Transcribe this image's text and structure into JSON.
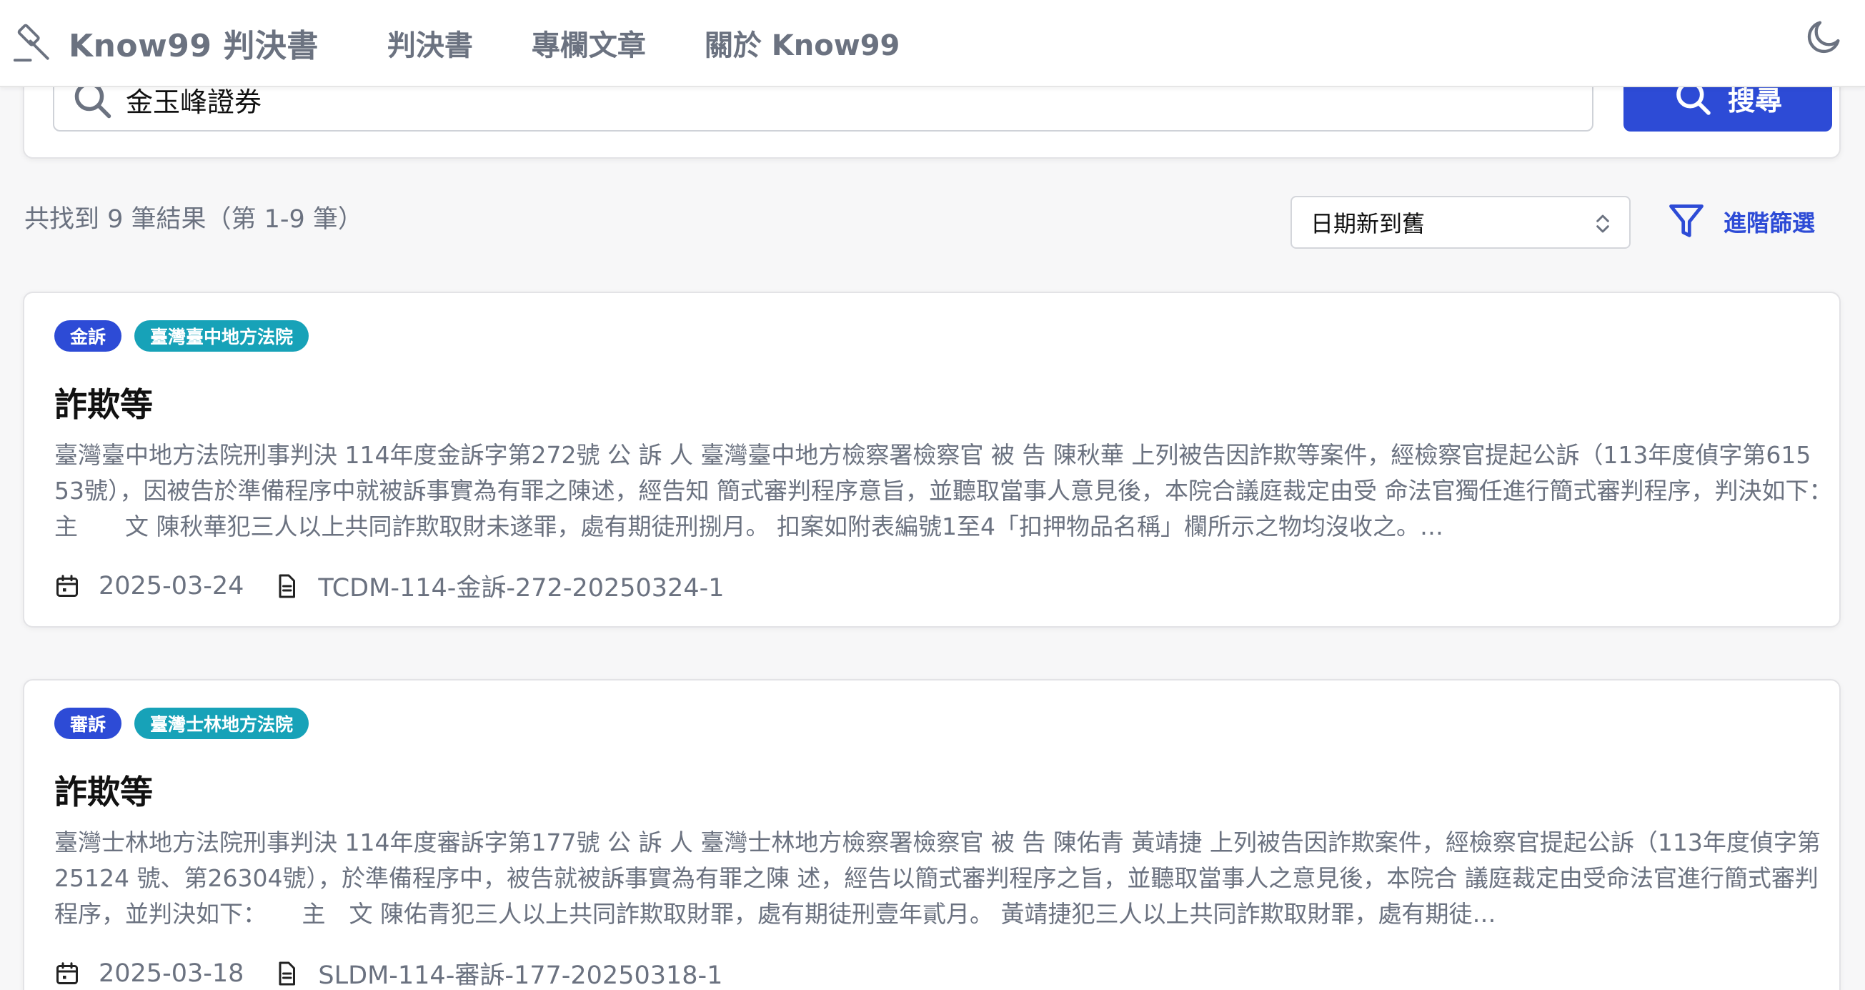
{
  "header": {
    "brand": "Know99 判決書",
    "nav": [
      "判決書",
      "專欄文章",
      "關於 Know99"
    ]
  },
  "search": {
    "query": "金玉峰證券",
    "button_label": "搜尋"
  },
  "results": {
    "count_text": "共找到 9 筆結果（第 1-9 筆）",
    "sort_selected": "日期新到舊",
    "advanced_filter_label": "進階篩選",
    "items": [
      {
        "type_badge": "金訴",
        "court_badge": "臺灣臺中地方法院",
        "title": "詐欺等",
        "excerpt": "臺灣臺中地方法院刑事判決 114年度金訴字第272號 公 訴 人 臺灣臺中地方檢察署檢察官 被 告 陳秋華 上列被告因詐欺等案件，經檢察官提起公訴（113年度偵字第615 53號），因被告於準備程序中就被訴事實為有罪之陳述，經告知 簡式審判程序意旨，並聽取當事人意見後，本院合議庭裁定由受 命法官獨任進行簡式審判程序，判決如下：　　主　　文 陳秋華犯三人以上共同詐欺取財未遂罪，處有期徒刑捌月。 扣案如附表編號1至4「扣押物品名稱」欄所示之物均沒收之。…",
        "date": "2025-03-24",
        "doc_id": "TCDM-114-金訴-272-20250324-1"
      },
      {
        "type_badge": "審訴",
        "court_badge": "臺灣士林地方法院",
        "title": "詐欺等",
        "excerpt": "臺灣士林地方法院刑事判決 114年度審訴字第177號 公 訴 人 臺灣士林地方檢察署檢察官 被 告 陳佑青 黃靖捷 上列被告因詐欺案件，經檢察官提起公訴（113年度偵字第25124 號、第26304號），於準備程序中，被告就被訴事實為有罪之陳 述，經告以簡式審判程序之旨，並聽取當事人之意見後，本院合 議庭裁定由受命法官進行簡式審判程序，並判決如下：　　主　文 陳佑青犯三人以上共同詐欺取財罪，處有期徒刑壹年貳月。 黃靖捷犯三人以上共同詐欺取財罪，處有期徒…",
        "date": "2025-03-18",
        "doc_id": "SLDM-114-審訴-177-20250318-1"
      }
    ]
  }
}
